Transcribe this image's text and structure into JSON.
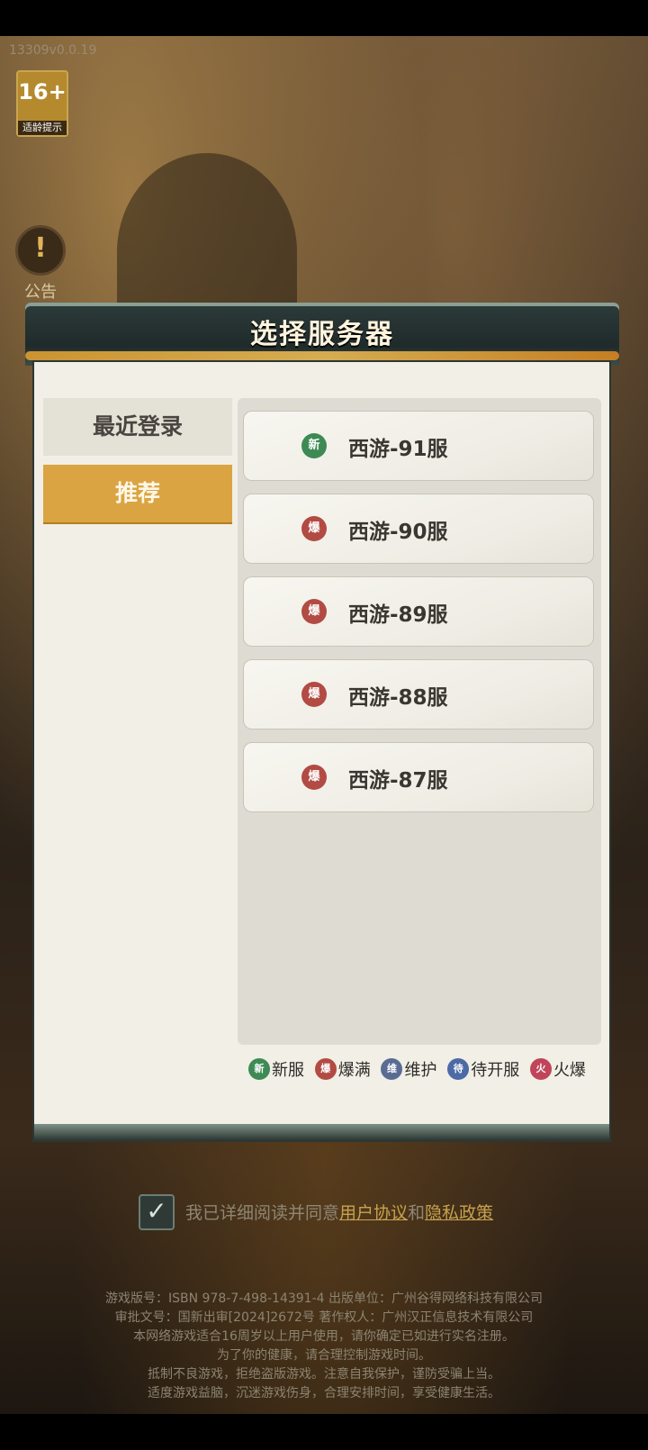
{
  "version": "13309v0.0.19",
  "age_badge": {
    "number": "16+",
    "label": "适龄提示"
  },
  "notice": {
    "label": "公告",
    "icon": "exclamation-icon"
  },
  "modal": {
    "title": "选择服务器",
    "tabs": [
      {
        "label": "最近登录",
        "active": false
      },
      {
        "label": "推荐",
        "active": true
      }
    ],
    "servers": [
      {
        "name": "西游-91服",
        "status": "new",
        "badge": "新"
      },
      {
        "name": "西游-90服",
        "status": "full",
        "badge": "爆"
      },
      {
        "name": "西游-89服",
        "status": "full",
        "badge": "爆"
      },
      {
        "name": "西游-88服",
        "status": "full",
        "badge": "爆"
      },
      {
        "name": "西游-87服",
        "status": "full",
        "badge": "爆"
      }
    ],
    "legend": [
      {
        "badge": "新",
        "label": "新服",
        "color": "#3e8a55"
      },
      {
        "badge": "爆",
        "label": "爆满",
        "color": "#b24b43"
      },
      {
        "badge": "维",
        "label": "维护",
        "color": "#5a6c93"
      },
      {
        "badge": "待",
        "label": "待开服",
        "color": "#4c6aa6"
      },
      {
        "badge": "火",
        "label": "火爆",
        "color": "#c0455a"
      }
    ]
  },
  "agreement": {
    "checked": true,
    "prefix": "我已详细阅读并同意",
    "user_agreement": "用户协议",
    "conj": "和",
    "privacy_policy": "隐私政策"
  },
  "legal": [
    "游戏版号：ISBN 978-7-498-14391-4  出版单位：广州谷得网络科技有限公司",
    "审批文号：国新出审[2024]2672号  著作权人：广州汉正信息技术有限公司",
    "本网络游戏适合16周岁以上用户使用，请你确定已如进行实名注册。",
    "为了你的健康，请合理控制游戏时间。",
    "抵制不良游戏，拒绝盗版游戏。注意自我保护，谨防受骗上当。",
    "适度游戏益脑，沉迷游戏伤身，合理安排时间，享受健康生活。"
  ]
}
